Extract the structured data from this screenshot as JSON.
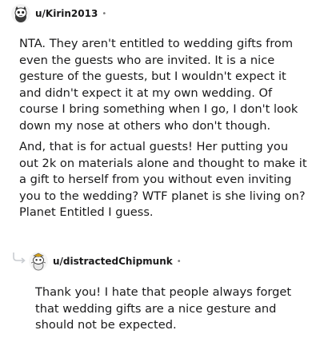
{
  "comments": [
    {
      "username": "u/Kirin2013",
      "separator": "•",
      "avatar_icon": "snoo-avatar-icon",
      "paragraphs": [
        "NTA. They aren't entitled to wedding gifts from even the guests who are invited. It is a nice gesture of the guests, but I wouldn't expect it and didn't expect it at my own wedding. Of course I bring something when I go, I don't look down my nose at others who don't though.",
        "And, that is for actual guests! Her putting you out 2k on materials alone and thought to make it a gift to herself from you without even inviting you to the wedding? WTF planet is she living on? Planet Entitled I guess."
      ]
    },
    {
      "username": "u/distractedChipmunk",
      "separator": "•",
      "avatar_icon": "snoo-avatar-icon",
      "reply_icon": "reply-arrow-icon",
      "paragraphs": [
        "Thank you! I hate that people always forget that wedding gifts are a nice gesture and should not be expected."
      ]
    }
  ],
  "colors": {
    "text": "#1a1a1b",
    "meta": "#7c7c7c",
    "thread_line": "#c8ccd0"
  }
}
